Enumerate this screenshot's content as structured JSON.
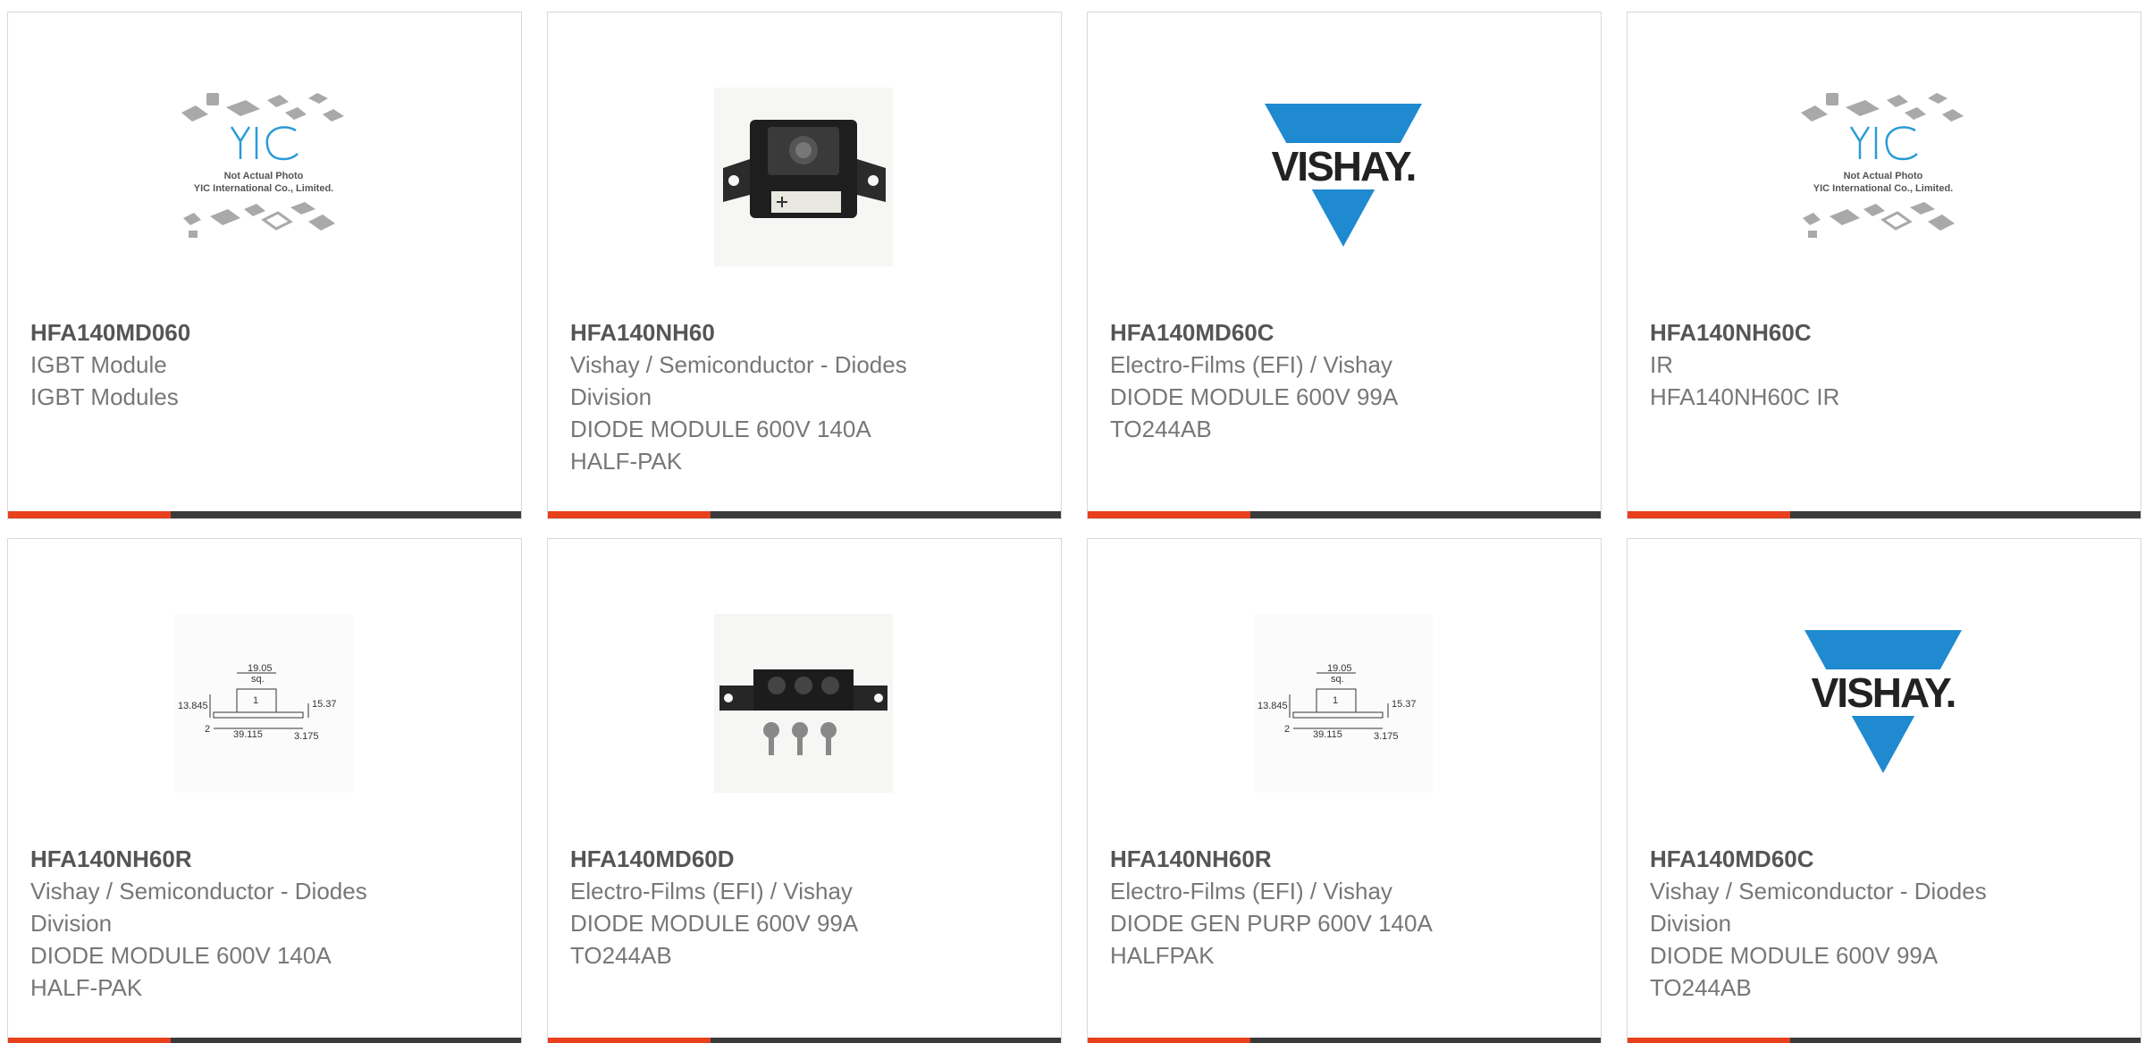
{
  "products": [
    {
      "part_number": "HFA140MD060",
      "image_icon": "yic-not-actual-photo-icon",
      "image_caption": "Not Actual Photo",
      "image_caption2": "YIC International Co., Limited.",
      "logo_text": "YIC",
      "lines": [
        "IGBT Module",
        "IGBT Modules"
      ]
    },
    {
      "part_number": "HFA140NH60",
      "image_icon": "diode-module-photo-icon",
      "lines": [
        "Vishay / Semiconductor - Diodes",
        "Division",
        "DIODE MODULE 600V 140A",
        "HALF-PAK"
      ]
    },
    {
      "part_number": "HFA140MD60C",
      "image_icon": "vishay-logo-icon",
      "logo_text": "VISHAY.",
      "lines": [
        "Electro-Films (EFI) / Vishay",
        "DIODE MODULE 600V 99A",
        "TO244AB"
      ]
    },
    {
      "part_number": "HFA140NH60C",
      "image_icon": "yic-not-actual-photo-icon",
      "image_caption": "Not Actual Photo",
      "image_caption2": "YIC International Co., Limited.",
      "logo_text": "YIC",
      "lines": [
        "IR",
        "HFA140NH60C IR"
      ]
    },
    {
      "part_number": "HFA140NH60R",
      "image_icon": "dimension-drawing-icon",
      "dimensions": [
        "19.05",
        "sq.",
        "13.845",
        "15.37",
        "39.115",
        "3.175",
        "1",
        "2"
      ],
      "lines": [
        "Vishay / Semiconductor - Diodes",
        "Division",
        "DIODE MODULE 600V 140A",
        "HALF-PAK"
      ]
    },
    {
      "part_number": "HFA140MD60D",
      "image_icon": "three-terminal-module-photo-icon",
      "lines": [
        "Electro-Films (EFI) / Vishay",
        "DIODE MODULE 600V 99A",
        "TO244AB"
      ]
    },
    {
      "part_number": "HFA140NH60R",
      "image_icon": "dimension-drawing-icon",
      "dimensions": [
        "19.05",
        "sq.",
        "13.845",
        "15.37",
        "39.115",
        "3.175",
        "1",
        "2"
      ],
      "lines": [
        "Electro-Films (EFI) / Vishay",
        "DIODE GEN PURP 600V 140A",
        "HALFPAK"
      ]
    },
    {
      "part_number": "HFA140MD60C",
      "image_icon": "vishay-logo-icon",
      "logo_text": "VISHAY.",
      "lines": [
        "Vishay / Semiconductor - Diodes",
        "Division",
        "DIODE MODULE 600V 99A",
        "TO244AB"
      ]
    }
  ],
  "colors": {
    "accent": "#e8401c",
    "bar": "#3a3a3a",
    "vishay_blue": "#1f8ad0",
    "yic_blue": "#2a9bd6"
  }
}
